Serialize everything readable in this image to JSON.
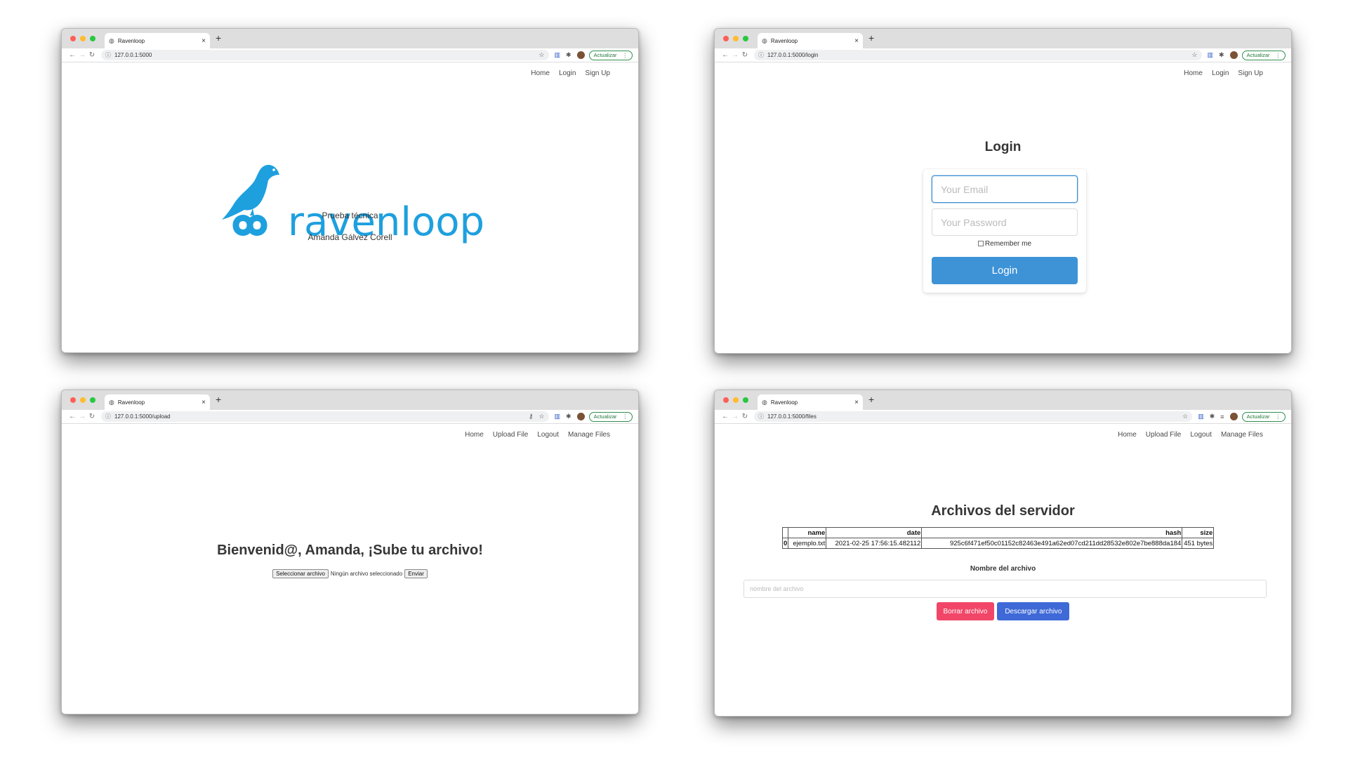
{
  "common": {
    "update_label": "Actualizar",
    "menu_dots": "⋮"
  },
  "windows": [
    {
      "tab_title": "Ravenloop",
      "url": "127.0.0.1:5000",
      "nav": [
        "Home",
        "Login",
        "Sign Up"
      ],
      "logo_text": "ravenloop",
      "logo_color": "#1ea0de",
      "line1": "Prueba técnica",
      "line2": "Amanda Gálvez Corell"
    },
    {
      "tab_title": "Ravenloop",
      "url": "127.0.0.1:5000/login",
      "nav": [
        "Home",
        "Login",
        "Sign Up"
      ],
      "heading": "Login",
      "email_placeholder": "Your Email",
      "password_placeholder": "Your Password",
      "remember_label": "Remember me",
      "button_label": "Login"
    },
    {
      "tab_title": "Ravenloop",
      "url": "127.0.0.1:5000/upload",
      "nav": [
        "Home",
        "Upload File",
        "Logout",
        "Manage Files"
      ],
      "heading": "Bienvenid@, Amanda, ¡Sube tu archivo!",
      "choose_label": "Seleccionar archivo",
      "no_file_label": "Ningún archivo seleccionado",
      "submit_label": "Enviar"
    },
    {
      "tab_title": "Ravenloop",
      "url": "127.0.0.1:5000/files",
      "nav": [
        "Home",
        "Upload File",
        "Logout",
        "Manage Files"
      ],
      "heading": "Archivos del servidor",
      "table": {
        "columns": [
          "",
          "name",
          "date",
          "hash",
          "size"
        ],
        "rows": [
          [
            "0",
            "ejemplo.txt",
            "2021-02-25 17:56:15.482112",
            "925c6f471ef50c01152c82463e491a62ed07cd211dd28532e802e7be888da184",
            "451 bytes"
          ]
        ]
      },
      "field_label": "Nombre del archivo",
      "field_placeholder": "nombre del archivo",
      "delete_label": "Borrar archivo",
      "download_label": "Descargar archivo"
    }
  ]
}
